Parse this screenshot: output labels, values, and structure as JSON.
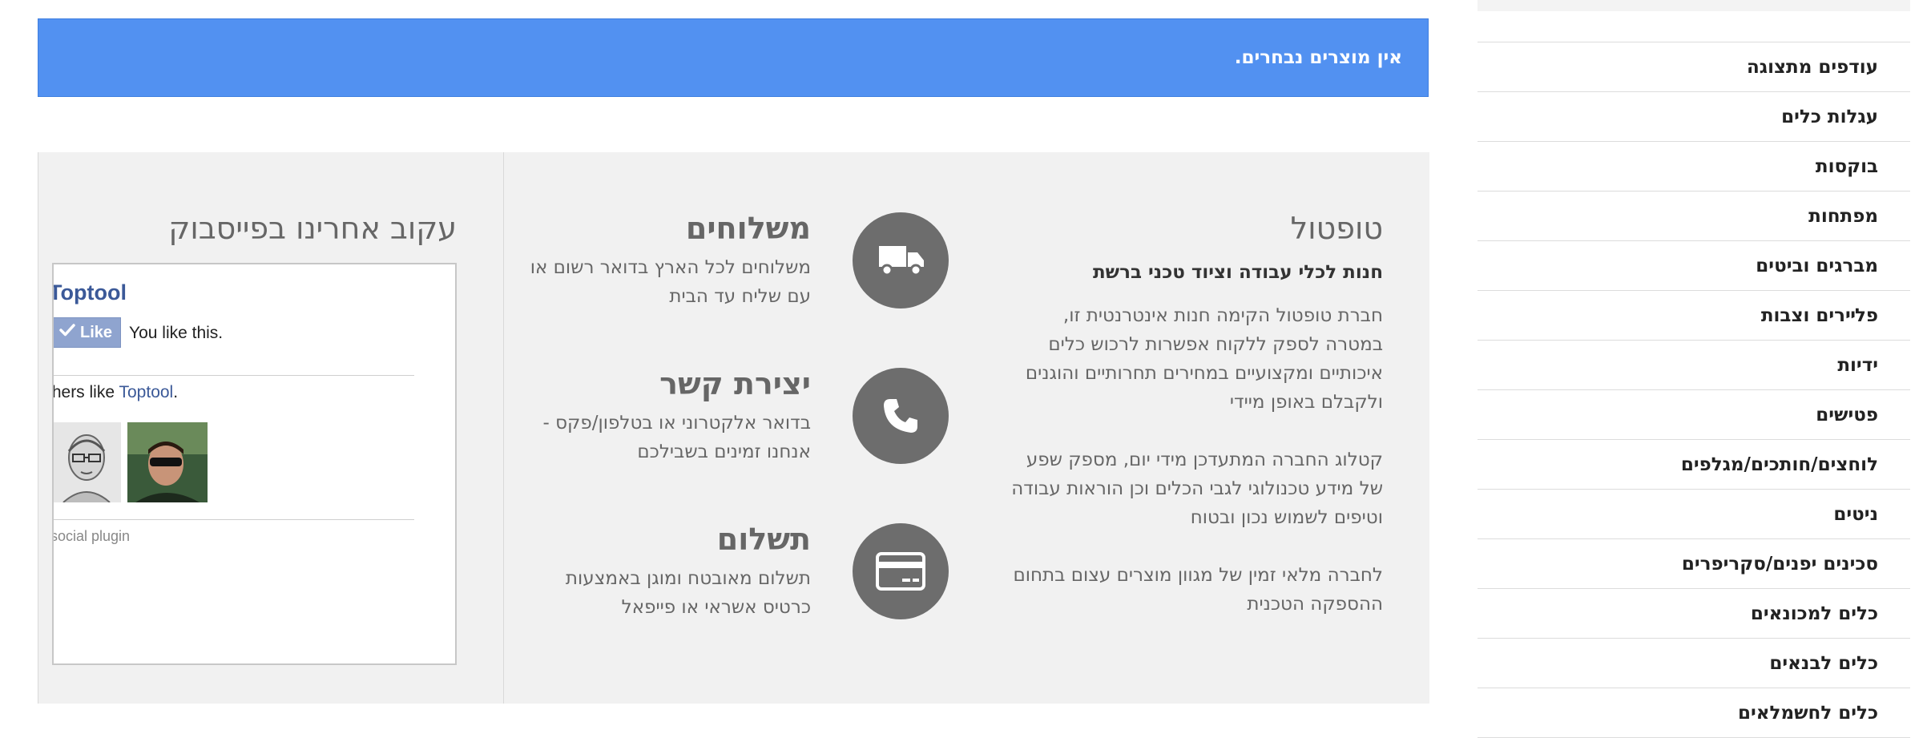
{
  "sidebar": {
    "items": [
      {
        "label": "עודפים מתצוגה"
      },
      {
        "label": "עגלות כלים"
      },
      {
        "label": "בוקסות"
      },
      {
        "label": "מפתחות"
      },
      {
        "label": "מברגים וביטים"
      },
      {
        "label": "פלײרים וצבות"
      },
      {
        "label": "ידיות"
      },
      {
        "label": "פטישים"
      },
      {
        "label": "לוחצים/חותכים/מגלפים"
      },
      {
        "label": "ניטים"
      },
      {
        "label": "סכינים יפנים/סקריפרים"
      },
      {
        "label": "כלים למכונאים"
      },
      {
        "label": "כלים לבנאים"
      },
      {
        "label": "כלים לחשמלאים"
      }
    ]
  },
  "alert": {
    "text": "אין מוצרים נבחרים."
  },
  "facebook": {
    "title": "עקוב אחרינו בפייסבוק",
    "page_name": "Toptool",
    "like_label": "Like",
    "you_like": "You like this.",
    "others_prefix": "thers like ",
    "others_link": "Toptool",
    "others_suffix": ".",
    "plugin_text": "social plugin"
  },
  "services": [
    {
      "icon": "truck-icon",
      "title": "משלוחים",
      "desc": "משלוחים לכל הארץ בדואר רשום או עם שליח עד הבית"
    },
    {
      "icon": "phone-icon",
      "title": "יצירת קשר",
      "desc": "בדואר אלקטרוני או בטלפון/פקס - אנחנו זמינים בשבילכם"
    },
    {
      "icon": "credit-card-icon",
      "title": "תשלום",
      "desc": "תשלום מאובטח ומוגן באמצעות כרטיס אשראי או פייפאל"
    }
  ],
  "about": {
    "title": "טופטול",
    "subtitle": "חנות לכלי עבודה וציוד טכני ברשת",
    "paragraphs": [
      "חברת טופטול הקימה חנות אינטרנטית זו, במטרה לספק ללקוח אפשרות לרכוש כלים איכותיים ומקצועיים במחירים תחרותיים והוגנים ולקבלם באופן מיידי",
      "קטלוג החברה המתעדכן מידי יום, מספק שפע של מידע טכנולוגי לגבי הכלים וכן הוראות עבודה וטיפים לשמוש נכון ובטוח",
      "לחברה מלאי זמין של מגוון מוצרים עצום בתחום ההספקה הטכנית"
    ]
  },
  "colors": {
    "alert_bg": "#5291f1",
    "icon_circle": "#6d6d6d",
    "fb_blue": "#3b5998",
    "panel_bg": "#f1f1f1"
  }
}
